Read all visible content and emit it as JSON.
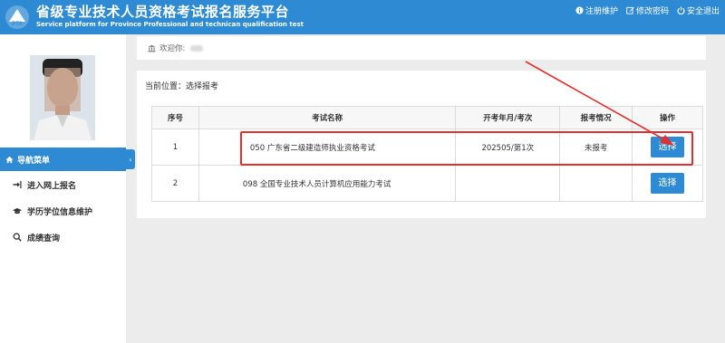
{
  "header": {
    "title_cn": "省级专业技术人员资格考试报名服务平台",
    "title_en": "Service platform for Province Professional and technican qualification test",
    "links": [
      {
        "label": "注册维护",
        "icon": "info-icon"
      },
      {
        "label": "修改密码",
        "icon": "edit-icon"
      },
      {
        "label": "安全退出",
        "icon": "power-icon"
      }
    ]
  },
  "sidebar": {
    "nav_title": "导航菜单",
    "items": [
      {
        "label": "进入网上报名",
        "icon": "sign-in-icon"
      },
      {
        "label": "学历学位信息维护",
        "icon": "graduation-cap-icon"
      },
      {
        "label": "成绩查询",
        "icon": "search-icon"
      }
    ]
  },
  "welcome": {
    "label": "欢迎你:"
  },
  "main": {
    "breadcrumb": "当前位置：选择报考",
    "table": {
      "headers": [
        "序号",
        "考试名称",
        "开考年月/考次",
        "报考情况",
        "操作"
      ],
      "rows": [
        {
          "no": "1",
          "name": "050 广东省二级建造师执业资格考试",
          "date": "202505/第1次",
          "status": "未报考",
          "action": "选择"
        },
        {
          "no": "2",
          "name": "098 全国专业技术人员计算机应用能力考试",
          "date": "",
          "status": "",
          "action": "选择"
        }
      ]
    }
  },
  "colors": {
    "primary": "#2e8bd3",
    "highlight": "#e0302f"
  }
}
